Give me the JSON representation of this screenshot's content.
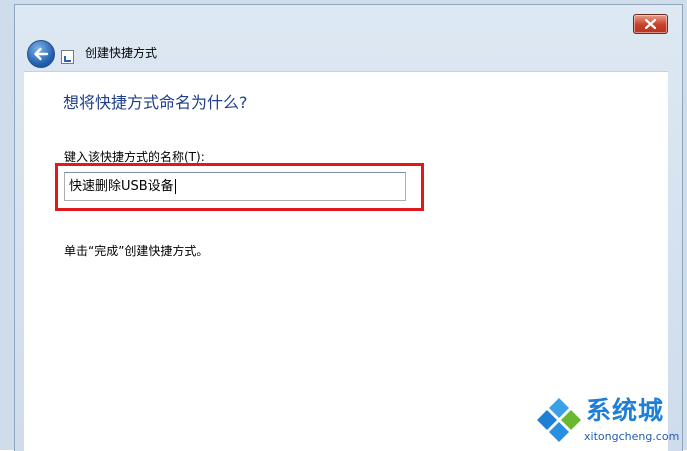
{
  "window": {
    "title": "创建快捷方式",
    "close_icon": "close-x-icon",
    "back_icon": "back-arrow-icon",
    "title_icon": "shortcut-icon"
  },
  "page": {
    "heading": "想将快捷方式命名为什么?",
    "field_label": "键入该快捷方式的名称(T):",
    "input_value": "快速删除USB设备",
    "hint": "单击“完成”创建快捷方式。"
  },
  "annotation": {
    "highlight_color": "#e01a1a"
  },
  "watermark": {
    "name": "系统城",
    "url": "xitongcheng.com"
  },
  "colors": {
    "heading": "#1e3f8a",
    "close_button": "#c8402a",
    "back_button": "#1f5fb0",
    "watermark": "#1f7fd6"
  }
}
